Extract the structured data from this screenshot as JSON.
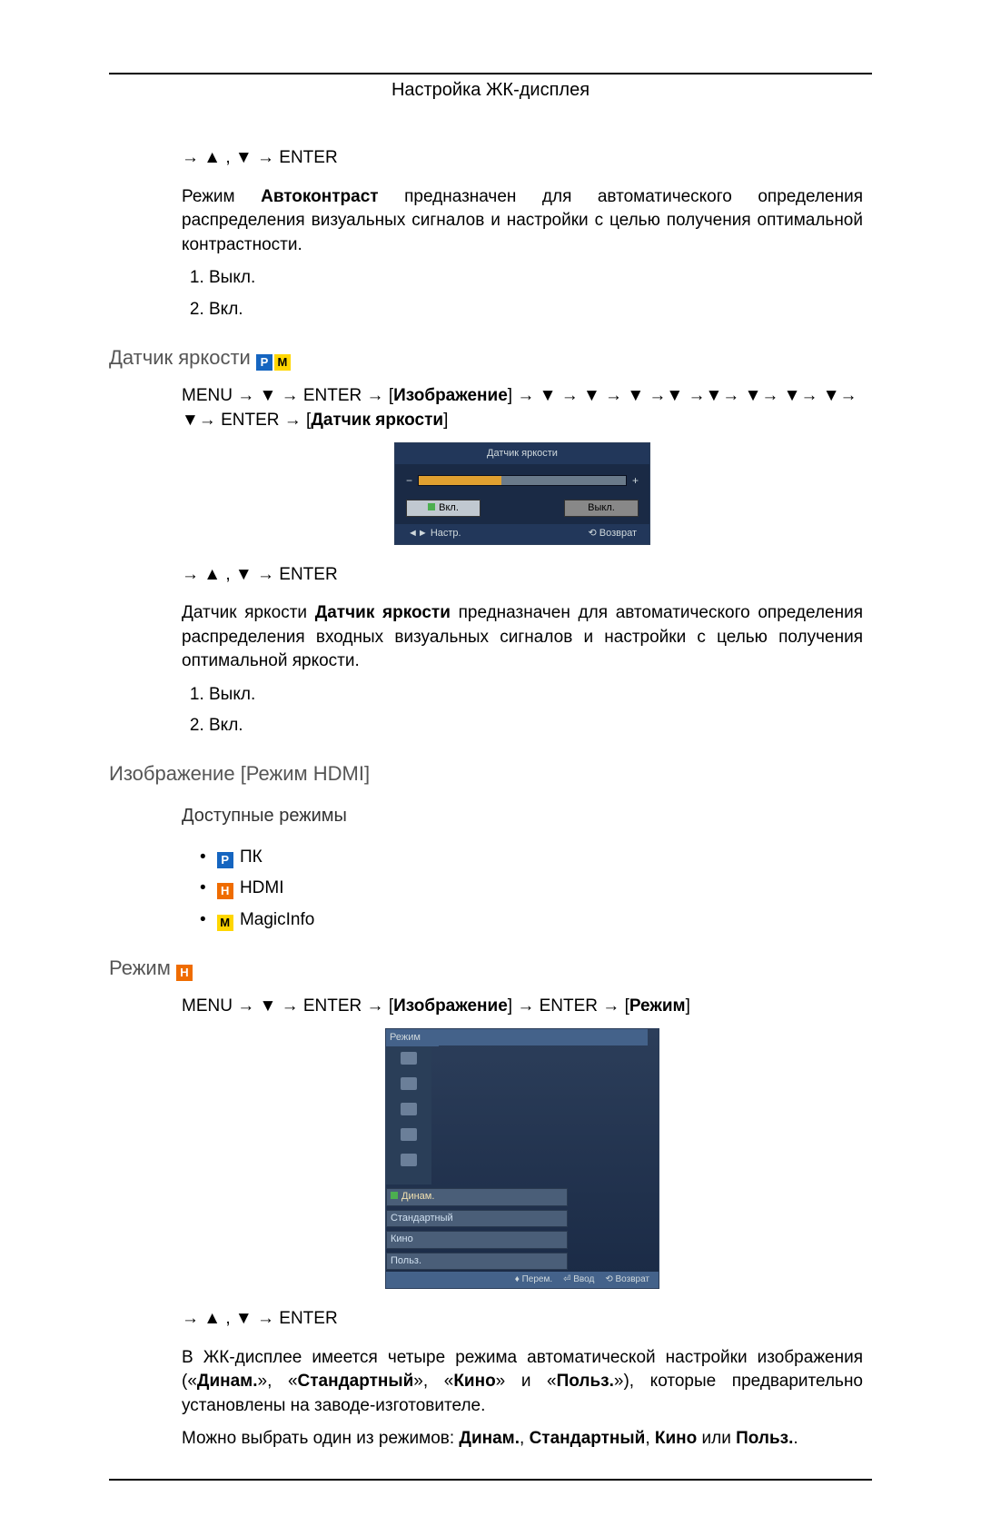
{
  "headerTitle": "Настройка ЖК-дисплея",
  "navEnter1": "→ ▲ , ▼ → ENTER",
  "autoContrastDesc": [
    "Режим ",
    "Автоконтраст",
    " предназначен для автоматического определения распределения визуальных сигналов и настройки с целью получения оптимальной контрастности."
  ],
  "onOff": {
    "off": "Выкл.",
    "on": "Вкл."
  },
  "sensorHeading": "Датчик яркости",
  "sensorPath": [
    "MENU → ▼ → ENTER → ",
    "[",
    "Изображение",
    "]",
    " → ▼ → ▼ → ▼ →▼ →▼→ ▼→ ▼→ ▼→ ▼→ ENTER → ",
    "[",
    "Датчик яркости",
    "]"
  ],
  "osd1": {
    "title": "Датчик яркости",
    "on": "Вкл.",
    "off": "Выкл.",
    "nav": "◄► Настр.",
    "ret": "⟲ Возврат"
  },
  "sensorDesc": [
    "Датчик яркости ",
    "Датчик яркости",
    " предназначен для автоматического определения распределения входных визуальных сигналов и настройки с целью получения оптимальной яркости."
  ],
  "hdmiHeading": "Изображение [Режим HDMI]",
  "availModes": "Доступные режимы",
  "modes": {
    "pc": "ПК",
    "hdmi": "HDMI",
    "magic": "MagicInfo"
  },
  "modeTitle": "Режим",
  "modePath": [
    "MENU → ▼ → ENTER → ",
    "[",
    "Изображение",
    "]",
    " → ENTER → ",
    "[",
    "Режим",
    "]"
  ],
  "osd2": {
    "title": "Режим",
    "opts": [
      "Динам.",
      "Стандартный",
      "Кино",
      "Польз."
    ],
    "move": "♦ Перем.",
    "enter": "⏎ Ввод",
    "ret": "⟲ Возврат"
  },
  "modeDesc": [
    "В ЖК-дисплее имеется четыре режима автоматической настройки изображения («",
    "Динам.",
    "», «",
    "Стандартный",
    "», «",
    "Кино",
    "» и «",
    "Польз.",
    "»), которые предварительно установлены на заводе-изготовителе."
  ],
  "modeChoice": [
    "Можно выбрать один из режимов: ",
    "Динам.",
    ", ",
    "Стандартный",
    ", ",
    "Кино",
    " или ",
    "Польз.",
    "."
  ]
}
